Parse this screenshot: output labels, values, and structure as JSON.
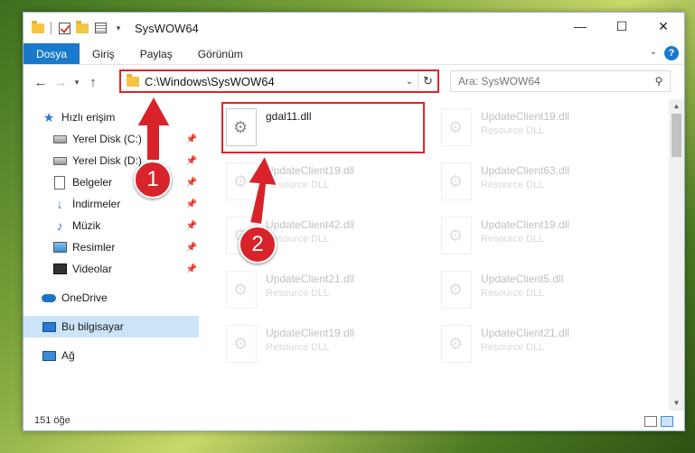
{
  "window": {
    "title": "SysWOW64",
    "minimize": "—",
    "maximize": "☐",
    "close": "✕"
  },
  "ribbon": {
    "tabs": [
      "Dosya",
      "Giriş",
      "Paylaş",
      "Görünüm"
    ],
    "help": "?"
  },
  "nav": {
    "address": "C:\\Windows\\SysWOW64",
    "search_placeholder": "Ara: SysWOW64"
  },
  "sidebar": {
    "quick_access": "Hızlı erişim",
    "pinned": [
      "Yerel Disk (C:)",
      "Yerel Disk (D:)",
      "Belgeler",
      "İndirmeler",
      "Müzik",
      "Resimler",
      "Videolar"
    ],
    "onedrive": "OneDrive",
    "this_pc": "Bu bilgisayar",
    "network": "Ağ"
  },
  "files": {
    "highlighted": {
      "name": "gdal11.dll"
    },
    "left": [
      {
        "name": "UpdateClient19.dll",
        "type": "Resource DLL"
      },
      {
        "name": "UpdateClient42.dll",
        "type": "Resource DLL"
      },
      {
        "name": "UpdateClient21.dll",
        "type": "Resource DLL"
      },
      {
        "name": "UpdateClient19.dll",
        "type": "Resource DLL"
      }
    ],
    "right": [
      {
        "name": "UpdateClient19.dll",
        "type": "Resource DLL"
      },
      {
        "name": "UpdateClient63.dll",
        "type": "Resource DLL"
      },
      {
        "name": "UpdateClient19.dll",
        "type": "Resource DLL"
      },
      {
        "name": "UpdateClient5.dll",
        "type": "Resource DLL"
      },
      {
        "name": "UpdateClient21.dll",
        "type": "Resource DLL"
      }
    ]
  },
  "status": {
    "count": "151 öğe"
  },
  "annotations": {
    "step1": "1",
    "step2": "2",
    "color": "#d8232a"
  }
}
